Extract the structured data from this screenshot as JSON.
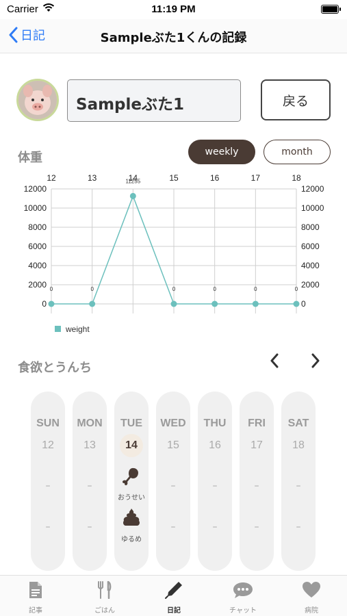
{
  "status_bar": {
    "carrier": "Carrier",
    "time": "11:19 PM"
  },
  "nav": {
    "back_label": "日記",
    "title": "Sampleぶた1くんの記録"
  },
  "profile": {
    "name": "Sampleぶた1",
    "return_label": "戻る"
  },
  "weight_section": {
    "title": "体重",
    "segments": [
      {
        "label": "weekly",
        "selected": true
      },
      {
        "label": "month",
        "selected": false
      }
    ]
  },
  "chart_data": {
    "type": "line",
    "x": [
      12,
      13,
      14,
      15,
      16,
      17,
      18
    ],
    "series": [
      {
        "name": "weight",
        "values": [
          0,
          0,
          11255,
          0,
          0,
          0,
          0
        ],
        "color": "#6cc0bd"
      }
    ],
    "point_labels": [
      "0",
      "0",
      "11255",
      "0",
      "0",
      "0",
      "0"
    ],
    "y_ticks": [
      0,
      2000,
      4000,
      6000,
      8000,
      10000,
      12000
    ],
    "ylim": [
      0,
      12000
    ],
    "legend_position": "bottom-left",
    "grid": true
  },
  "appetite_section": {
    "title": "食欲とうんち"
  },
  "week": [
    {
      "day": "SUN",
      "date": "12",
      "food": "–",
      "poop": "–",
      "selected": false
    },
    {
      "day": "MON",
      "date": "13",
      "food": "–",
      "poop": "–",
      "selected": false
    },
    {
      "day": "TUE",
      "date": "14",
      "food": "おうせい",
      "poop": "ゆるめ",
      "selected": true
    },
    {
      "day": "WED",
      "date": "15",
      "food": "–",
      "poop": "–",
      "selected": false
    },
    {
      "day": "THU",
      "date": "16",
      "food": "–",
      "poop": "–",
      "selected": false
    },
    {
      "day": "FRI",
      "date": "17",
      "food": "–",
      "poop": "–",
      "selected": false
    },
    {
      "day": "SAT",
      "date": "18",
      "food": "–",
      "poop": "–",
      "selected": false
    }
  ],
  "tabs": [
    {
      "label": "記事",
      "icon": "document-icon"
    },
    {
      "label": "ごはん",
      "icon": "fork-knife-icon"
    },
    {
      "label": "日記",
      "icon": "pen-icon",
      "active": true
    },
    {
      "label": "チャット",
      "icon": "chat-bubble-icon"
    },
    {
      "label": "病院",
      "icon": "heart-icon"
    }
  ],
  "colors": {
    "accent": "#4a3b34",
    "link": "#2f7cf6",
    "series": "#6cc0bd"
  }
}
